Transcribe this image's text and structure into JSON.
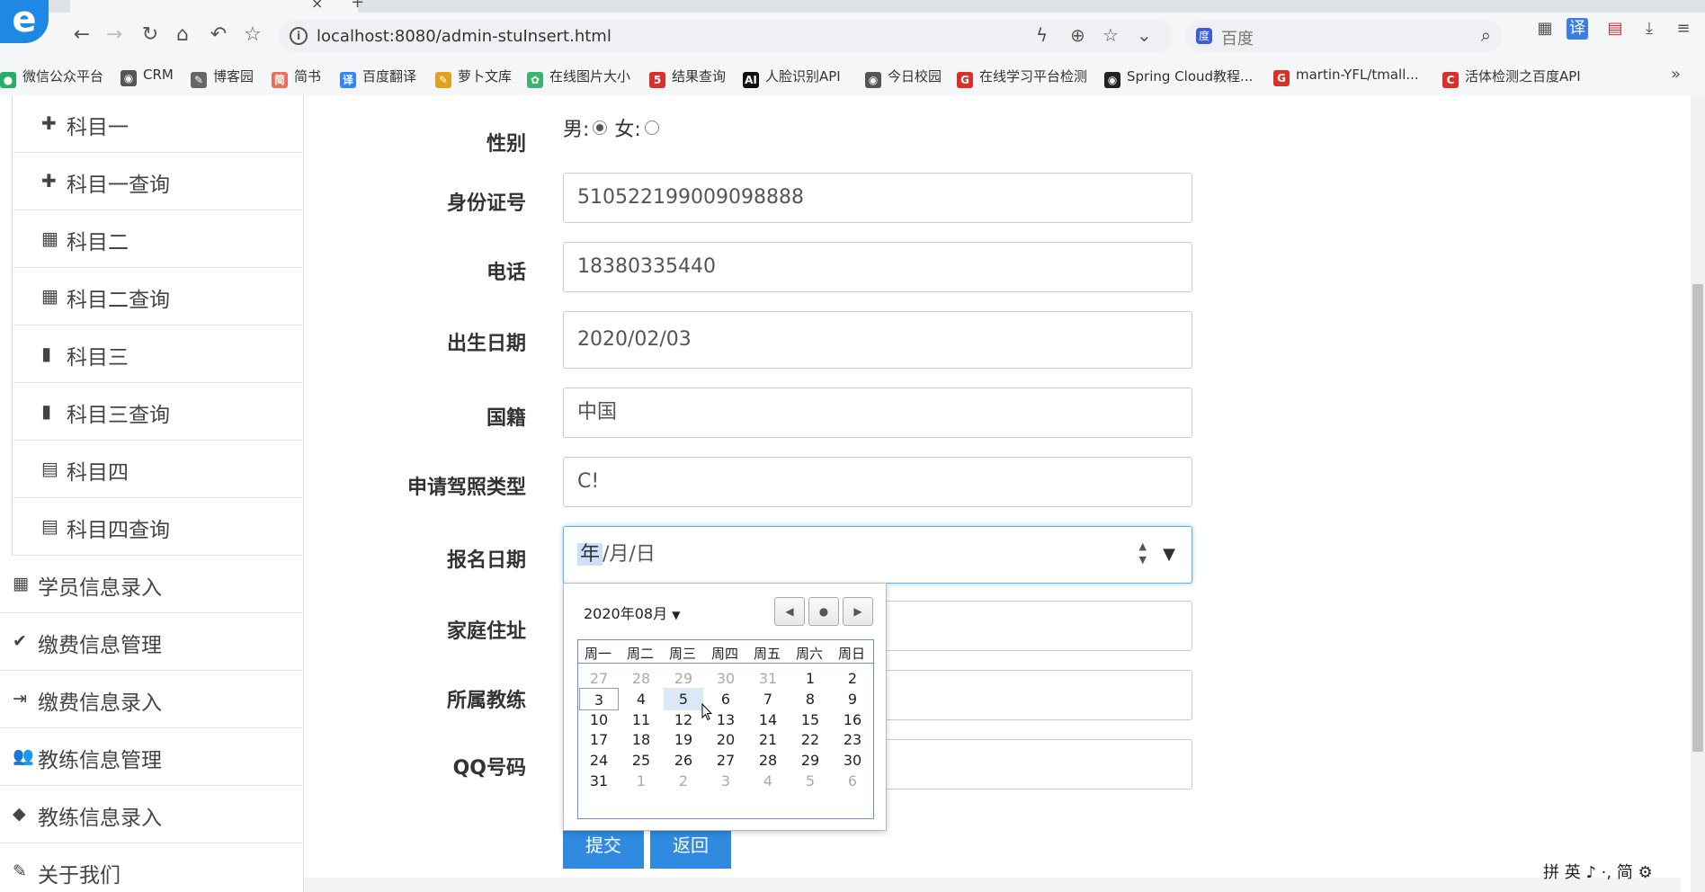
{
  "browser": {
    "url": "localhost:8080/admin-stuInsert.html",
    "search_placeholder": "百度",
    "bookmarks": [
      {
        "label": "微信公众平台",
        "color": "#2aae67"
      },
      {
        "label": "CRM",
        "color": "#555555"
      },
      {
        "label": "博客园",
        "color": "#666666"
      },
      {
        "label": "简书",
        "color": "#ea6f5a"
      },
      {
        "label": "百度翻译",
        "color": "#3385ff"
      },
      {
        "label": "萝卜文库",
        "color": "#e0a020"
      },
      {
        "label": "在线图片大小",
        "color": "#3cb371"
      },
      {
        "label": "结果查询",
        "color": "#d9302c"
      },
      {
        "label": "人脸识别API",
        "color": "#111111"
      },
      {
        "label": "今日校园",
        "color": "#555555"
      },
      {
        "label": "在线学习平台检测",
        "color": "#d9302c"
      },
      {
        "label": "Spring Cloud教程...",
        "color": "#222222"
      },
      {
        "label": "martin-YFL/tmall...",
        "color": "#d9302c"
      },
      {
        "label": "活体检测之百度API",
        "color": "#d9302c"
      }
    ],
    "more": "»"
  },
  "sidebar": {
    "sub_items": [
      {
        "label": "科目一",
        "icon": "puzzle-icon"
      },
      {
        "label": "科目一查询",
        "icon": "puzzle-icon"
      },
      {
        "label": "科目二",
        "icon": "grid-icon"
      },
      {
        "label": "科目二查询",
        "icon": "grid-icon"
      },
      {
        "label": "科目三",
        "icon": "bookmark-icon"
      },
      {
        "label": "科目三查询",
        "icon": "bookmark-icon"
      },
      {
        "label": "科目四",
        "icon": "calendar-icon"
      },
      {
        "label": "科目四查询",
        "icon": "calendar-icon"
      }
    ],
    "main_items": [
      {
        "label": "学员信息录入",
        "icon": "table-icon"
      },
      {
        "label": "缴费信息管理",
        "icon": "check-icon"
      },
      {
        "label": "缴费信息录入",
        "icon": "sign-in-icon"
      },
      {
        "label": "教练信息管理",
        "icon": "users-icon"
      },
      {
        "label": "教练信息录入",
        "icon": "tag-icon"
      },
      {
        "label": "关于我们",
        "icon": "edit-icon"
      }
    ]
  },
  "form": {
    "gender": {
      "label": "性别",
      "male": "男:",
      "female": "女:",
      "selected": "male"
    },
    "id_card": {
      "label": "身份证号",
      "value": "510522199009098888"
    },
    "phone": {
      "label": "电话",
      "value": "18380335440"
    },
    "birth_date": {
      "label": "出生日期",
      "value": "2020/02/03"
    },
    "nationality": {
      "label": "国籍",
      "value": "中国"
    },
    "license_type": {
      "label": "申请驾照类型",
      "value": "C!"
    },
    "reg_date": {
      "label": "报名日期",
      "year": "年",
      "rest": "/月/日"
    },
    "address": {
      "label": "家庭住址",
      "value": ""
    },
    "coach": {
      "label": "所属教练",
      "value": ""
    },
    "qq": {
      "label": "QQ号码",
      "value": ""
    },
    "submit_label": "提交",
    "back_label": "返回"
  },
  "calendar": {
    "month_label": "2020年08月",
    "weekdays": [
      "周一",
      "周二",
      "周三",
      "周四",
      "周五",
      "周六",
      "周日"
    ],
    "weeks": [
      [
        "27",
        "28",
        "29",
        "30",
        "31",
        "1",
        "2"
      ],
      [
        "3",
        "4",
        "5",
        "6",
        "7",
        "8",
        "9"
      ],
      [
        "10",
        "11",
        "12",
        "13",
        "14",
        "15",
        "16"
      ],
      [
        "17",
        "18",
        "19",
        "20",
        "21",
        "22",
        "23"
      ],
      [
        "24",
        "25",
        "26",
        "27",
        "28",
        "29",
        "30"
      ],
      [
        "31",
        "1",
        "2",
        "3",
        "4",
        "5",
        "6"
      ]
    ],
    "dim_first_row_count": 5,
    "dim_last_row_from": 1,
    "today": "3",
    "hover": "5"
  },
  "ime": "拼 英 ♪ ·, 简 ⚙"
}
